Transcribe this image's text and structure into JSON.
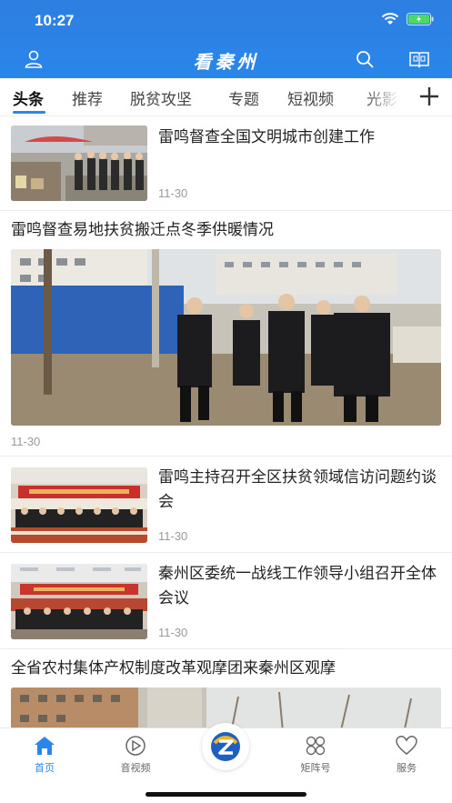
{
  "status_bar": {
    "time": "10:27"
  },
  "header": {
    "title": "看秦州"
  },
  "tabs": [
    {
      "label": "头条"
    },
    {
      "label": "推荐"
    },
    {
      "label": "脱贫攻坚"
    },
    {
      "label": "专题"
    },
    {
      "label": "短视频"
    },
    {
      "label": "光影"
    }
  ],
  "feed": [
    {
      "title": "雷鸣督查全国文明城市创建工作",
      "date": "11-30",
      "layout": "thumb"
    },
    {
      "title": "雷鸣督查易地扶贫搬迁点冬季供暖情况",
      "date": "11-30",
      "layout": "big"
    },
    {
      "title": "雷鸣主持召开全区扶贫领域信访问题约谈会",
      "date": "11-30",
      "layout": "thumb"
    },
    {
      "title": "秦州区委统一战线工作领导小组召开全体会议",
      "date": "11-30",
      "layout": "thumb"
    },
    {
      "title": "全省农村集体产权制度改革观摩团来秦州区观摩",
      "layout": "big"
    }
  ],
  "bottom_nav": [
    {
      "label": "首页",
      "icon": "home-icon"
    },
    {
      "label": "音视频",
      "icon": "play-icon"
    },
    {
      "label": "",
      "icon": "app-logo-icon"
    },
    {
      "label": "矩阵号",
      "icon": "matrix-icon"
    },
    {
      "label": "服务",
      "icon": "heart-icon"
    }
  ],
  "colors": {
    "accent": "#2a86ea"
  }
}
